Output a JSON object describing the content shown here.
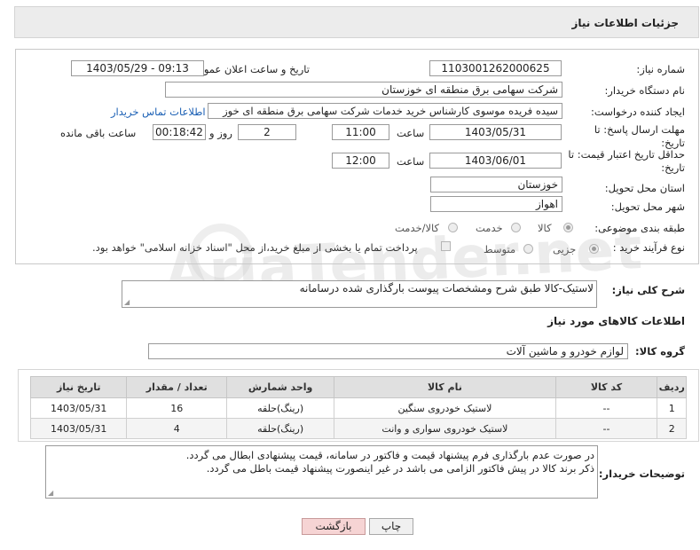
{
  "header": {
    "title": "جزئیات اطلاعات نیاز"
  },
  "watermark": {
    "text": "AriaTender.net"
  },
  "form": {
    "need_number_label": "شماره نیاز:",
    "need_number": "1103001262000625",
    "announce_label": "تاریخ و ساعت اعلان عمومی:",
    "announce_value": "1403/05/29 - 09:13",
    "buyer_org_label": "نام دستگاه خریدار:",
    "buyer_org": "شرکت سهامی برق منطقه ای خوزستان",
    "requester_label": "ایجاد کننده درخواست:",
    "requester": "سیده فریده موسوی کارشناس خرید خدمات شرکت سهامی برق منطقه ای خوز",
    "contact_link": "اطلاعات تماس خریدار",
    "reply_deadline_label": "مهلت ارسال پاسخ: تا تاریخ:",
    "reply_date": "1403/05/31",
    "time_label": "ساعت",
    "reply_time": "11:00",
    "days_value": "2",
    "days_label": "روز و",
    "remaining_time": "00:18:42",
    "remaining_label": "ساعت باقی مانده",
    "validity_label": "حداقل تاریخ اعتبار قیمت: تا تاریخ:",
    "validity_date": "1403/06/01",
    "validity_time": "12:00",
    "province_label": "استان محل تحویل:",
    "province": "خوزستان",
    "city_label": "شهر محل تحویل:",
    "city": "اهواز",
    "category_label": "طبقه بندی موضوعی:",
    "category_options": [
      "کالا",
      "خدمت",
      "کالا/خدمت"
    ],
    "purchase_type_label": "نوع فرآیند خرید :",
    "purchase_options": [
      "جزیی",
      "متوسط"
    ],
    "treasury_note": "پرداخت تمام یا بخشی از مبلغ خرید،از محل \"اسناد خزانه اسلامی\" خواهد بود."
  },
  "description": {
    "label": "شرح کلی نیاز:",
    "value": "لاستیک-کالا طبق شرح ومشخصات پیوست بارگذاری شده درسامانه"
  },
  "goods": {
    "section_title": "اطلاعات کالاهای مورد نیاز",
    "group_label": "گروه کالا:",
    "group_value": "لوازم خودرو و ماشین آلات",
    "columns": [
      "ردیف",
      "کد کالا",
      "نام کالا",
      "واحد شمارش",
      "تعداد / مقدار",
      "تاریخ نیاز"
    ],
    "rows": [
      [
        "1",
        "--",
        "لاستیک خودروی سنگین",
        "(رینگ)حلقه",
        "16",
        "1403/05/31"
      ],
      [
        "2",
        "--",
        "لاستیک خودروی سواری و وانت",
        "(رینگ)حلقه",
        "4",
        "1403/05/31"
      ]
    ]
  },
  "buyer_notes": {
    "label": "توضیحات خریدار:",
    "lines": [
      "در صورت عدم بارگذاری فرم پیشنهاد قیمت و فاکتور در سامانه، قیمت پیشنهادی ابطال می گردد.",
      "ذکر برند کالا در پیش فاکتور الزامی می باشد در غیر اینصورت پیشنهاد قیمت باطل می گردد."
    ]
  },
  "buttons": {
    "print": "چاپ",
    "back": "بازگشت"
  },
  "colors": {
    "link": "#1a5fb4",
    "back_button_bg": "#f6d4d4",
    "header_bg": "#ececec"
  }
}
